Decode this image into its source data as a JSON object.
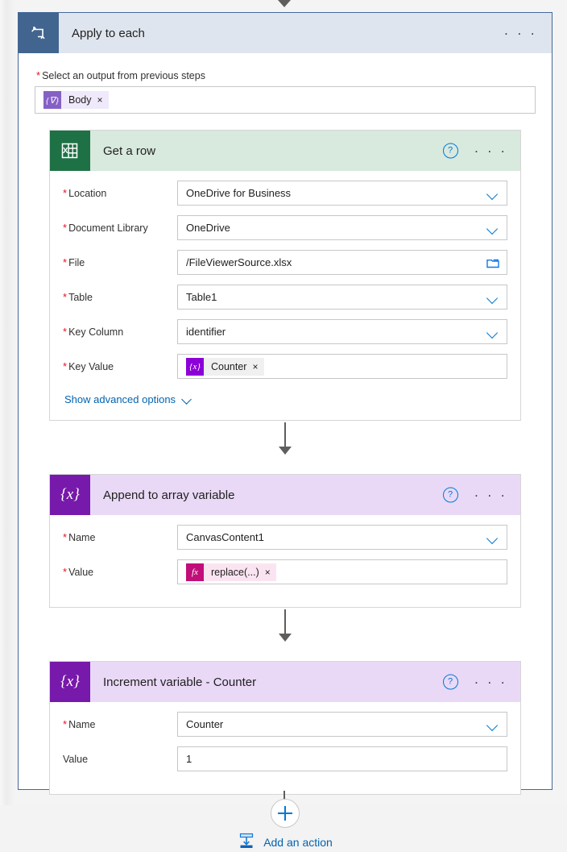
{
  "scope": {
    "icon": "loop-icon",
    "title": "Apply to each",
    "menu": "· · ·",
    "input_label": "Select an output from previous steps",
    "input_required": "*",
    "token": {
      "glyph": "{∇}",
      "label": "Body",
      "remove": "×"
    }
  },
  "cards": [
    {
      "id": "get-a-row",
      "icon": "excel-icon",
      "title": "Get a row",
      "help": "?",
      "menu": "· · ·",
      "fields": [
        {
          "label": "Location",
          "required": true,
          "value": "OneDrive for Business",
          "control": "dropdown"
        },
        {
          "label": "Document Library",
          "required": true,
          "value": "OneDrive",
          "control": "dropdown"
        },
        {
          "label": "File",
          "required": true,
          "value": "/FileViewerSource.xlsx",
          "control": "file-picker"
        },
        {
          "label": "Table",
          "required": true,
          "value": "Table1",
          "control": "dropdown"
        },
        {
          "label": "Key Column",
          "required": true,
          "value": "identifier",
          "control": "dropdown"
        },
        {
          "label": "Key Value",
          "required": true,
          "value": "",
          "control": "token",
          "token": {
            "kind": "variable",
            "glyph": "{x}",
            "label": "Counter",
            "remove": "×"
          }
        }
      ],
      "advanced_link": "Show advanced options"
    },
    {
      "id": "append-to-array-variable",
      "icon": "variables-icon",
      "title": "Append to array variable",
      "help": "?",
      "menu": "· · ·",
      "fields": [
        {
          "label": "Name",
          "required": true,
          "value": "CanvasContent1",
          "control": "dropdown"
        },
        {
          "label": "Value",
          "required": true,
          "value": "",
          "control": "token",
          "token": {
            "kind": "expression",
            "glyph": "fx",
            "label": "replace(...)",
            "remove": "×"
          }
        }
      ]
    },
    {
      "id": "increment-variable-counter",
      "icon": "variables-icon",
      "title": "Increment variable - Counter",
      "help": "?",
      "menu": "· · ·",
      "fields": [
        {
          "label": "Name",
          "required": true,
          "value": "Counter",
          "control": "dropdown"
        },
        {
          "label": "Value",
          "required": false,
          "value": "1",
          "control": "text"
        }
      ]
    }
  ],
  "add_action": {
    "icon": "add-step-icon",
    "label": "Add an action"
  },
  "colors": {
    "scope_border": "#44689a",
    "scope_header_bg": "#dfe5ee",
    "scope_icon_bg": "#41658f",
    "excel_icon_bg": "#1e7145",
    "excel_header_bg": "#d8e9de",
    "variable_icon_bg": "#7719aa",
    "variable_header_bg": "#e9d9f7",
    "link_blue": "#0363b0",
    "required_red": "#e81123",
    "token_body_glyph": "#8661c5",
    "token_variable_glyph": "#8c00d8",
    "token_expression_glyph": "#c10e79"
  }
}
